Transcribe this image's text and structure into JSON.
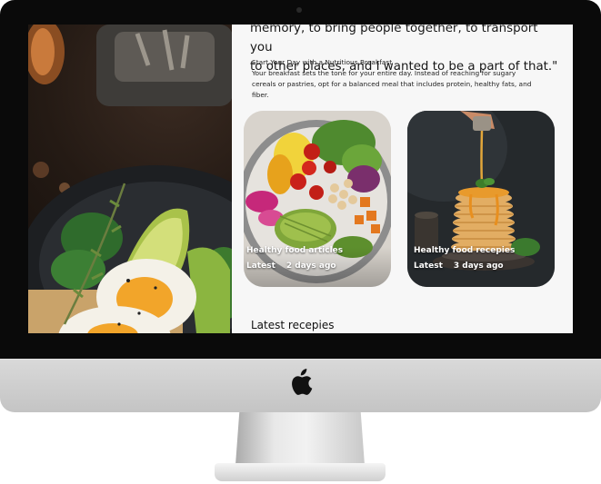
{
  "article": {
    "quote": "memory, to bring people together, to transport you\nto other places, and I wanted to be a part of that.\"",
    "section_title": "Start Your Day with a Nutritious Breakfast",
    "section_body": "Your breakfast sets the tone for your entire day. Instead of reaching for sugary cereals or pastries, opt for a balanced meal that includes protein, healthy fats, and fiber."
  },
  "cards": [
    {
      "title": "Healthy food articles",
      "meta_label": "Latest",
      "meta_time": "2 days ago"
    },
    {
      "title": "Healthy  food recepies",
      "meta_label": "Latest",
      "meta_time": "3 days ago"
    }
  ],
  "latest_section": {
    "title": "Latest recepies"
  },
  "device": {
    "logo": "apple-logo-icon"
  },
  "colors": {
    "bezel": "#0a0a0a",
    "screen_bg": "#f7f7f7",
    "chin": "#d0d0d0"
  }
}
